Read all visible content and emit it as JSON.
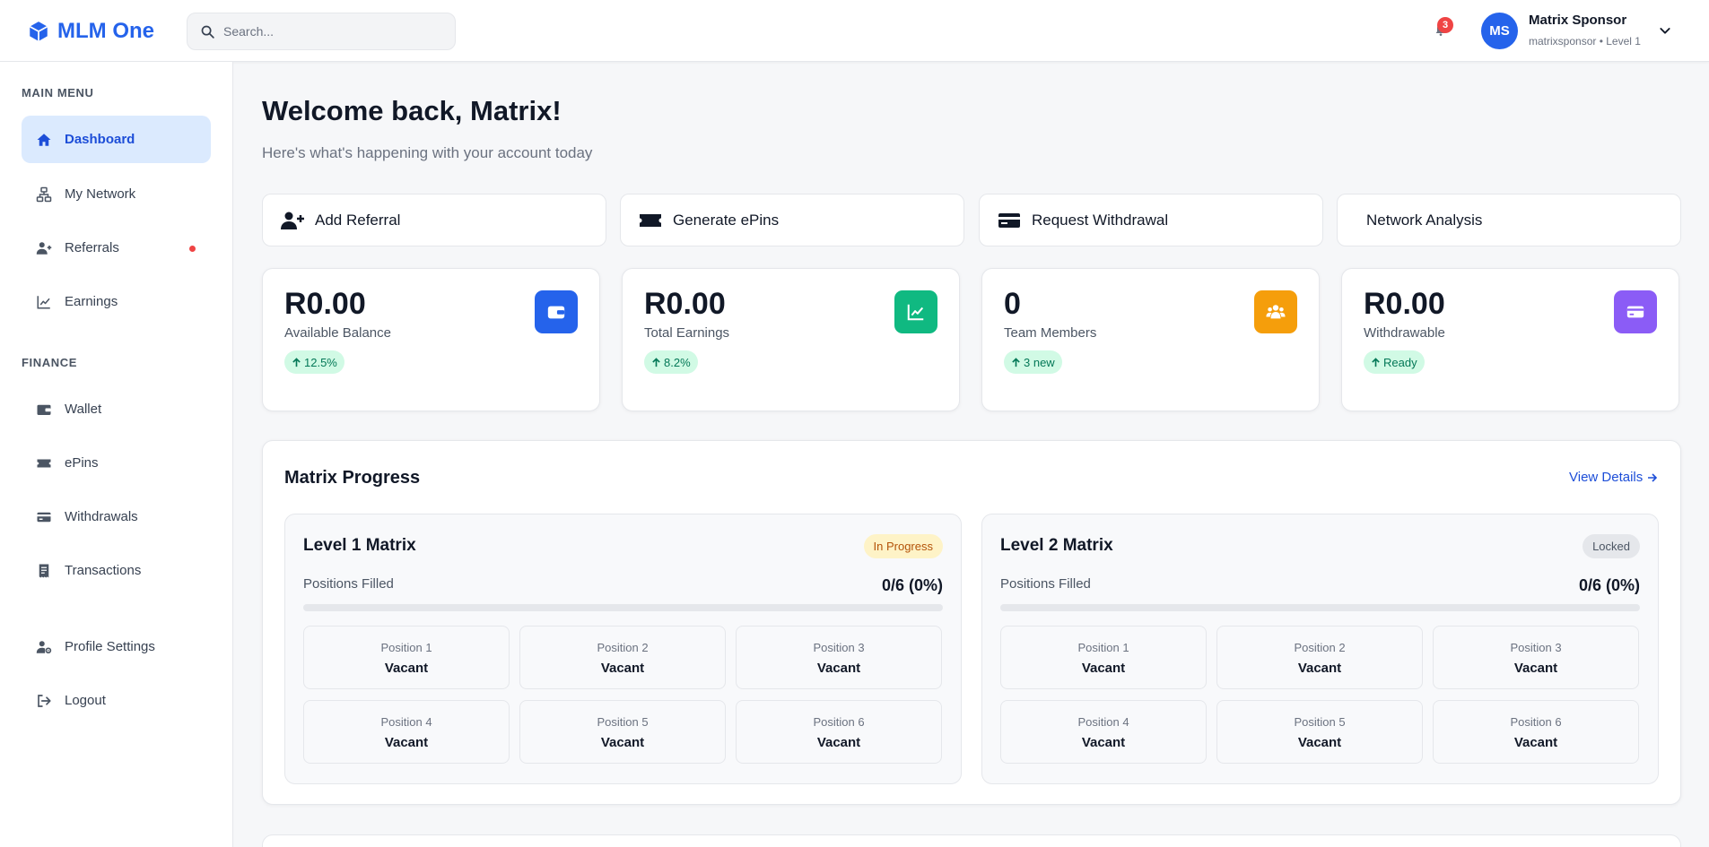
{
  "header": {
    "brand": "MLM One",
    "search_placeholder": "Search...",
    "notifications_count": "3",
    "user": {
      "initials": "MS",
      "name": "Matrix Sponsor",
      "subtitle": "matrixsponsor • Level 1"
    }
  },
  "sidebar": {
    "main_heading": "MAIN MENU",
    "finance_heading": "FINANCE",
    "items": [
      {
        "label": "Dashboard",
        "icon": "home-icon",
        "active": true
      },
      {
        "label": "My Network",
        "icon": "network-icon"
      },
      {
        "label": "Referrals",
        "icon": "user-plus-icon",
        "dot": true
      },
      {
        "label": "Earnings",
        "icon": "chart-line-icon"
      },
      {
        "label": "Wallet",
        "icon": "wallet-icon"
      },
      {
        "label": "ePins",
        "icon": "ticket-icon"
      },
      {
        "label": "Withdrawals",
        "icon": "credit-card-icon"
      },
      {
        "label": "Transactions",
        "icon": "receipt-icon"
      },
      {
        "label": "Profile Settings",
        "icon": "user-cog-icon"
      },
      {
        "label": "Logout",
        "icon": "logout-icon"
      }
    ]
  },
  "main": {
    "welcome": "Welcome back, Matrix!",
    "subtitle": "Here's what's happening with your account today",
    "quick_actions": [
      {
        "label": "Add Referral",
        "icon": "user-plus-icon"
      },
      {
        "label": "Generate ePins",
        "icon": "ticket-icon"
      },
      {
        "label": "Request Withdrawal",
        "icon": "credit-card-icon"
      },
      {
        "label": "Network Analysis",
        "icon": ""
      }
    ],
    "stats": [
      {
        "value": "R0.00",
        "label": "Available Balance",
        "chip": "12.5%",
        "icon": "wallet-icon",
        "color": "#2563eb"
      },
      {
        "value": "R0.00",
        "label": "Total Earnings",
        "chip": "8.2%",
        "icon": "chart-line-icon",
        "color": "#10b981"
      },
      {
        "value": "0",
        "label": "Team Members",
        "chip": "3 new",
        "icon": "users-icon",
        "color": "#f59e0b"
      },
      {
        "value": "R0.00",
        "label": "Withdrawable",
        "chip": "Ready",
        "icon": "credit-card-icon",
        "color": "#8b5cf6"
      }
    ],
    "matrix_progress": {
      "title": "Matrix Progress",
      "view_details": "View Details",
      "levels": [
        {
          "title": "Level 1 Matrix",
          "badge": "In Progress",
          "filled_label": "Positions Filled",
          "filled_value": "0/6 (0%)",
          "progress_percent": 0,
          "positions": [
            {
              "name": "Position 1",
              "status": "Vacant"
            },
            {
              "name": "Position 2",
              "status": "Vacant"
            },
            {
              "name": "Position 3",
              "status": "Vacant"
            },
            {
              "name": "Position 4",
              "status": "Vacant"
            },
            {
              "name": "Position 5",
              "status": "Vacant"
            },
            {
              "name": "Position 6",
              "status": "Vacant"
            }
          ]
        },
        {
          "title": "Level 2 Matrix",
          "badge": "Locked",
          "filled_label": "Positions Filled",
          "filled_value": "0/6 (0%)",
          "progress_percent": 0,
          "positions": [
            {
              "name": "Position 1",
              "status": "Vacant"
            },
            {
              "name": "Position 2",
              "status": "Vacant"
            },
            {
              "name": "Position 3",
              "status": "Vacant"
            },
            {
              "name": "Position 4",
              "status": "Vacant"
            },
            {
              "name": "Position 5",
              "status": "Vacant"
            },
            {
              "name": "Position 6",
              "status": "Vacant"
            }
          ]
        }
      ]
    }
  }
}
